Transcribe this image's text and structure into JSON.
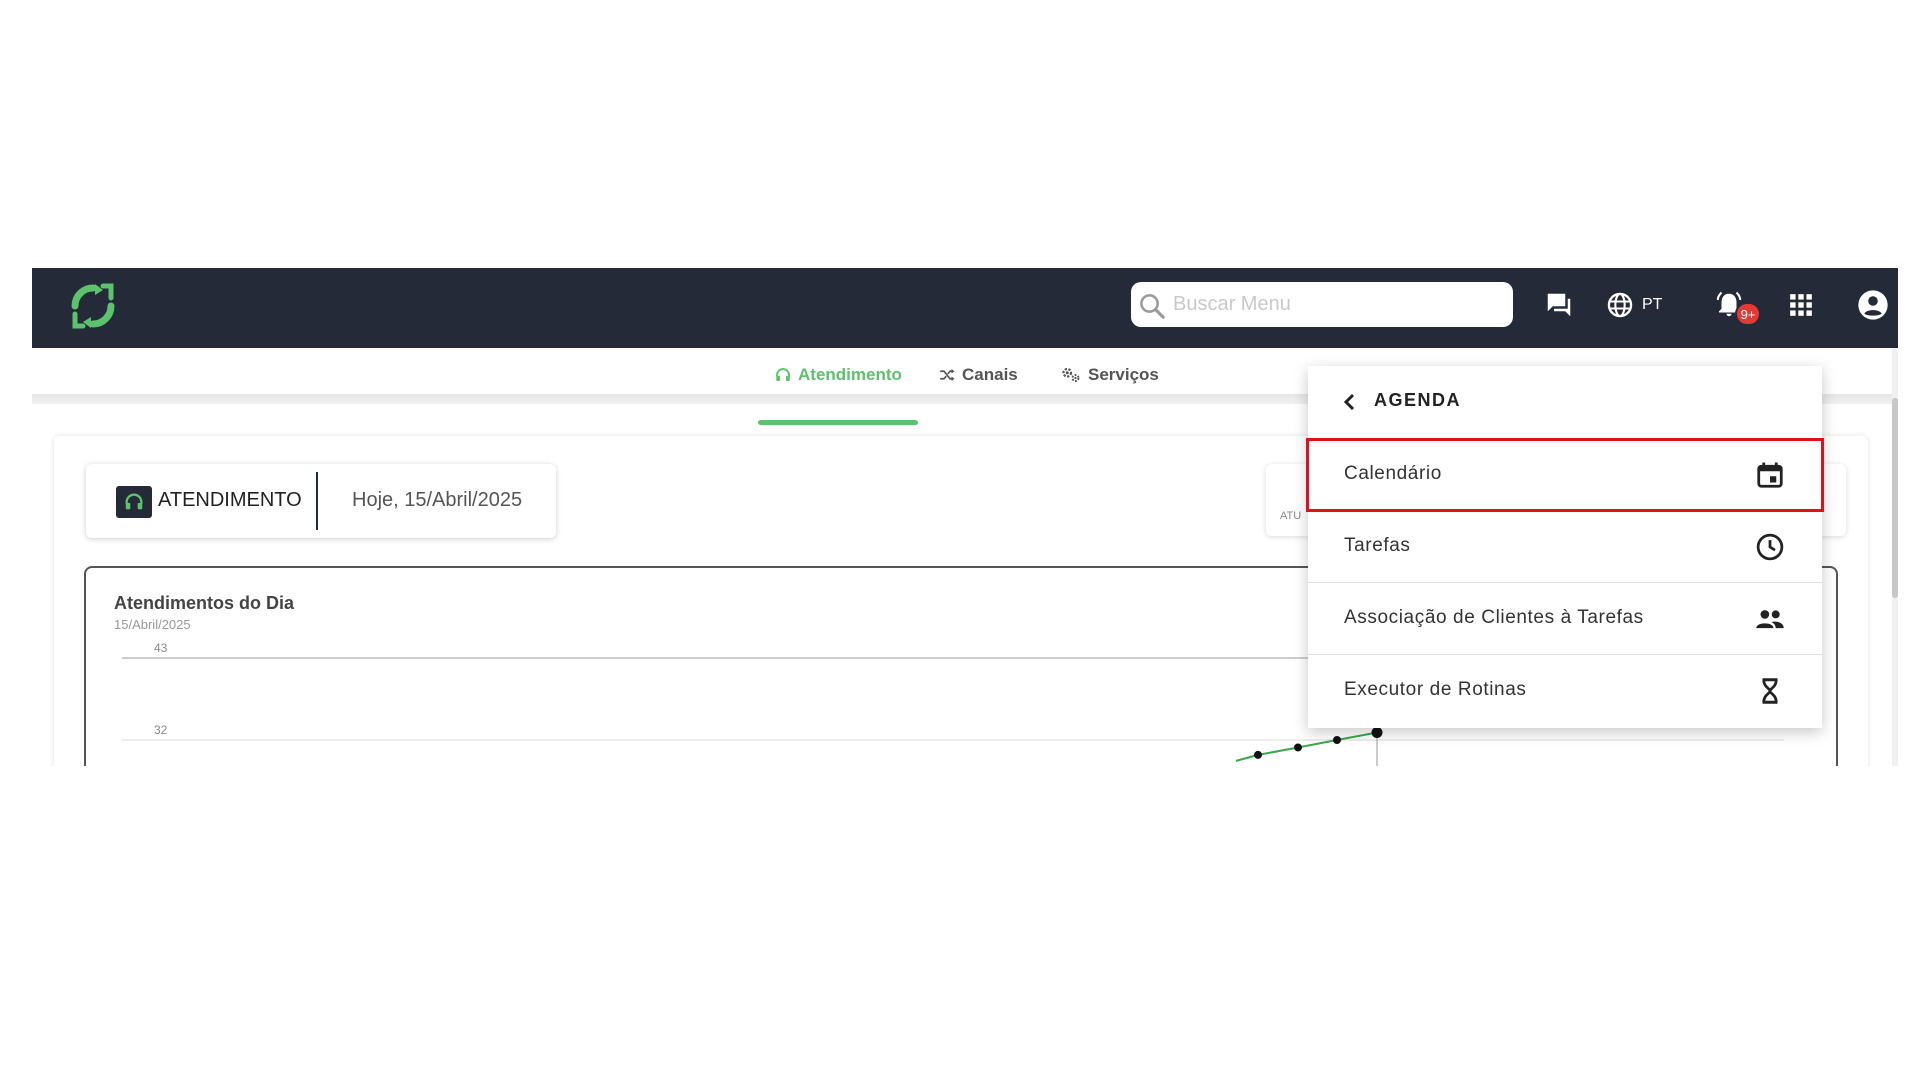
{
  "header": {
    "search_placeholder": "Buscar Menu",
    "language": "PT",
    "notifications_badge": "9+"
  },
  "tabs": [
    {
      "label": "Atendimento",
      "icon": "headset-icon",
      "active": true
    },
    {
      "label": "Canais",
      "icon": "shuffle-icon",
      "active": false
    },
    {
      "label": "Serviços",
      "icon": "gears-icon",
      "active": false
    }
  ],
  "info_card": {
    "label": "ATENDIMENTO",
    "date": "Hoje, 15/Abril/2025"
  },
  "side_card": {
    "partial_text": "ATU"
  },
  "chart_data": {
    "type": "line",
    "title": "Atendimentos do Dia",
    "subtitle": "15/Abril/2025",
    "y_ticks": [
      43,
      32
    ],
    "ylim": [
      0,
      43
    ],
    "series": [
      {
        "color": "#3aa84a",
        "values": [
          30,
          31,
          32,
          33
        ]
      }
    ]
  },
  "menu": {
    "title": "AGENDA",
    "items": [
      {
        "label": "Calendário",
        "icon": "calendar-icon",
        "highlighted": true
      },
      {
        "label": "Tarefas",
        "icon": "clock-icon",
        "highlighted": false
      },
      {
        "label": "Associação de Clientes à Tarefas",
        "icon": "people-icon",
        "highlighted": false
      },
      {
        "label": "Executor de Rotinas",
        "icon": "hourglass-icon",
        "highlighted": false
      }
    ]
  },
  "colors": {
    "topbar": "#242a38",
    "accent": "#5cc26c",
    "highlight": "#e0101a",
    "badge": "#e53935"
  }
}
